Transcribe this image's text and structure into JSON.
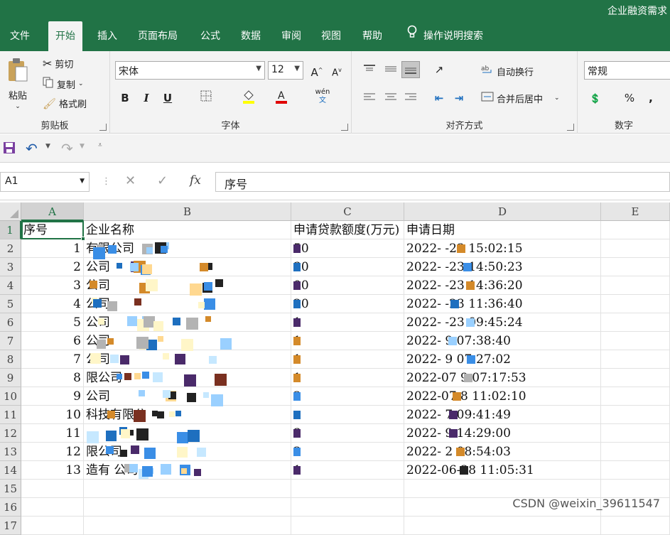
{
  "app": {
    "title": "企业融资需求"
  },
  "tabs": [
    {
      "label": "文件"
    },
    {
      "label": "开始"
    },
    {
      "label": "插入"
    },
    {
      "label": "页面布局"
    },
    {
      "label": "公式"
    },
    {
      "label": "数据"
    },
    {
      "label": "审阅"
    },
    {
      "label": "视图"
    },
    {
      "label": "帮助"
    },
    {
      "label": "操作说明搜索"
    }
  ],
  "ribbon": {
    "clipboard": {
      "label": "剪贴板",
      "paste": "粘贴",
      "cut": "剪切",
      "copy": "复制",
      "format_painter": "格式刷"
    },
    "font": {
      "label": "字体",
      "font_name": "宋体",
      "font_size": "12",
      "bold": "B",
      "italic": "I",
      "underline": "U",
      "phonetic": "wén"
    },
    "alignment": {
      "label": "对齐方式",
      "wrap_text": "自动换行",
      "merge_center": "合并后居中"
    },
    "number": {
      "label": "数字",
      "format": "常规",
      "percent": "%",
      "comma": ","
    }
  },
  "formula_bar": {
    "name_box": "A1",
    "fx": "fx",
    "value": "序号"
  },
  "columns": [
    "A",
    "B",
    "C",
    "D",
    "E"
  ],
  "rows": [
    {
      "n": "1",
      "a": "序号",
      "b": "企业名称",
      "c": "申请贷款额度(万元)",
      "d": "申请日期"
    },
    {
      "n": "2",
      "a": "1",
      "b": "有限公司",
      "c": "50",
      "d": "2022-  -23  15:02:15"
    },
    {
      "n": "3",
      "a": "2",
      "b": "公司",
      "c": "30",
      "d": "2022-  -23  14:50:23"
    },
    {
      "n": "4",
      "a": "3",
      "b": "公司",
      "c": "00",
      "d": "2022-  -23  14:36:20"
    },
    {
      "n": "5",
      "a": "4",
      "b": "公司",
      "c": "20",
      "d": "2022-  -23  11:36:40"
    },
    {
      "n": "6",
      "a": "5",
      "b": "公司",
      "c": "1",
      "d": "2022-  -23  09:45:24"
    },
    {
      "n": "7",
      "a": "6",
      "b": "公司",
      "c": "1",
      "d": "2022-    9  07:38:40"
    },
    {
      "n": "8",
      "a": "7",
      "b": "公司",
      "c": "1",
      "d": "2022-    9  07:27:02"
    },
    {
      "n": "9",
      "a": "8",
      "b": "限公司",
      "c": "1",
      "d": "2022-07   9  07:17:53"
    },
    {
      "n": "10",
      "a": "9",
      "b": "公司",
      "c": "2",
      "d": "2022-07   8  11:02:10"
    },
    {
      "n": "11",
      "a": "10",
      "b": "科技有限公",
      "c": "",
      "d": "2022-    7  09:41:49"
    },
    {
      "n": "12",
      "a": "11",
      "b": "",
      "c": "3",
      "d": "2022-    9  14:29:00"
    },
    {
      "n": "13",
      "a": "12",
      "b": "限公司",
      "c": "2",
      "d": "2022-    2  08:54:03"
    },
    {
      "n": "14",
      "a": "13",
      "b": "造有  公司",
      "c": "1",
      "d": "2022-06-28  11:05:31"
    },
    {
      "n": "15",
      "a": "",
      "b": "",
      "c": "",
      "d": ""
    },
    {
      "n": "16",
      "a": "",
      "b": "",
      "c": "",
      "d": ""
    },
    {
      "n": "17",
      "a": "",
      "b": "",
      "c": "",
      "d": ""
    }
  ],
  "watermark": "CSDN @weixin_39611547",
  "colors": {
    "excel_green": "#217346",
    "ribbon_bg": "#f3f3f3",
    "header_bg": "#e6e6e6"
  }
}
